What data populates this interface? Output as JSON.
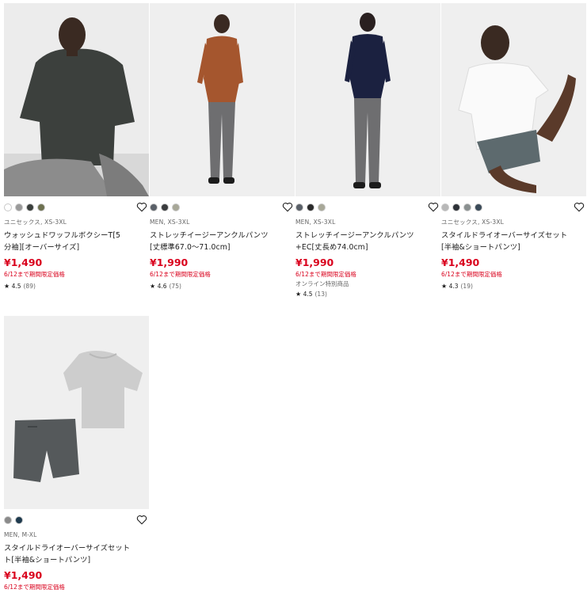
{
  "products": [
    {
      "swatches": [
        "#ffffff",
        "#9a9a9a",
        "#3a3f3c",
        "#6e7150"
      ],
      "gender": "ユニセックス, XS-3XL",
      "name_lines": [
        "ウォッシュドワッフルボクシーT[5",
        "分袖][オーバーサイズ]"
      ],
      "price": "¥1,490",
      "limited": "6/12まで期間限定価格",
      "online": "",
      "rating": "4.5",
      "reviews": "(89)"
    },
    {
      "swatches": [
        "#5a6068",
        "#3a3c3e",
        "#a8a898"
      ],
      "gender": "MEN, XS-3XL",
      "name_lines": [
        "ストレッチイージーアンクルパンツ",
        "[丈標準67.0～71.0cm]"
      ],
      "price": "¥1,990",
      "limited": "6/12まで期間限定価格",
      "online": "",
      "rating": "4.6",
      "reviews": "(75)"
    },
    {
      "swatches": [
        "#5a6068",
        "#2a2a2a",
        "#a8a898"
      ],
      "gender": "MEN, XS-3XL",
      "name_lines": [
        "ストレッチイージーアンクルパンツ",
        "+EC[丈長め74.0cm]"
      ],
      "price": "¥1,990",
      "limited": "6/12まで期間限定価格",
      "online": "オンライン特別商品",
      "rating": "4.5",
      "reviews": "(13)"
    },
    {
      "swatches": [
        "#b8b8b8",
        "#2e3238",
        "#8a9090",
        "#3a4a58"
      ],
      "gender": "ユニセックス, XS-3XL",
      "name_lines": [
        "スタイルドライオーバーサイズセット",
        "[半袖&ショートパンツ]"
      ],
      "price": "¥1,490",
      "limited": "6/12まで期間限定価格",
      "online": "",
      "rating": "4.3",
      "reviews": "(19)"
    },
    {
      "swatches": [
        "#8a8a8a",
        "#1e3a4e"
      ],
      "gender": "MEN, M-XL",
      "name_lines": [
        "スタイルドライオーバーサイズセット",
        "ト[半袖&ショートパンツ]"
      ],
      "price": "¥1,490",
      "limited": "6/12まで期間限定価格",
      "online": "",
      "rating": "",
      "reviews": ""
    }
  ],
  "icons": {
    "favorite": "heart-outline-icon",
    "rating": "star-icon"
  },
  "colors": {
    "price": "#d9001c",
    "sale_text": "#d9001c",
    "muted": "#666666"
  }
}
